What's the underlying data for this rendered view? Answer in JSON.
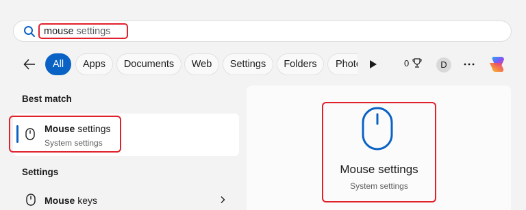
{
  "search": {
    "query_typed": "mouse",
    "query_suggest": " settings",
    "accent": "#0a62c4",
    "highlight_color": "#e0202a"
  },
  "filters": [
    {
      "label": "All",
      "active": true
    },
    {
      "label": "Apps",
      "active": false
    },
    {
      "label": "Documents",
      "active": false
    },
    {
      "label": "Web",
      "active": false
    },
    {
      "label": "Settings",
      "active": false
    },
    {
      "label": "Folders",
      "active": false
    },
    {
      "label": "Photo",
      "active": false
    }
  ],
  "toolbar": {
    "back_icon": "arrow-left-icon",
    "play_icon": "play-icon",
    "points": "0",
    "trophy_icon": "trophy-icon",
    "avatar_initial": "D",
    "more_icon": "more-icon",
    "copilot_icon": "copilot-icon"
  },
  "results": {
    "best_match_heading": "Best match",
    "best_match": {
      "title_bold": "Mouse",
      "title_rest": " settings",
      "subtitle": "System settings",
      "icon": "mouse-icon"
    },
    "settings_heading": "Settings",
    "settings_items": [
      {
        "label_bold": "Mouse",
        "label_rest": " keys",
        "icon": "mouse-icon"
      }
    ]
  },
  "preview": {
    "title": "Mouse settings",
    "subtitle": "System settings",
    "icon": "mouse-icon"
  }
}
